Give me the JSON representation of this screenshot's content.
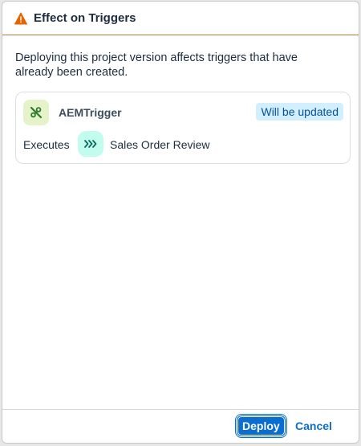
{
  "dialog": {
    "title": "Effect on Triggers",
    "title_icon": "warning-triangle-icon",
    "message": "Deploying this project version affects triggers that have already been created."
  },
  "trigger": {
    "icon": "event-trigger-icon",
    "name": "AEMTrigger",
    "status": "Will be updated",
    "executes_label": "Executes",
    "process_icon": "process-chevrons-icon",
    "process_name": "Sales Order Review"
  },
  "footer": {
    "deploy_label": "Deploy",
    "cancel_label": "Cancel"
  },
  "colors": {
    "warning": "#e76500",
    "accent": "#0a6ed1",
    "badge_bg": "#d1efff",
    "trigger_icon_bg": "#e6f2c9",
    "process_icon_bg": "#c2fcee"
  }
}
